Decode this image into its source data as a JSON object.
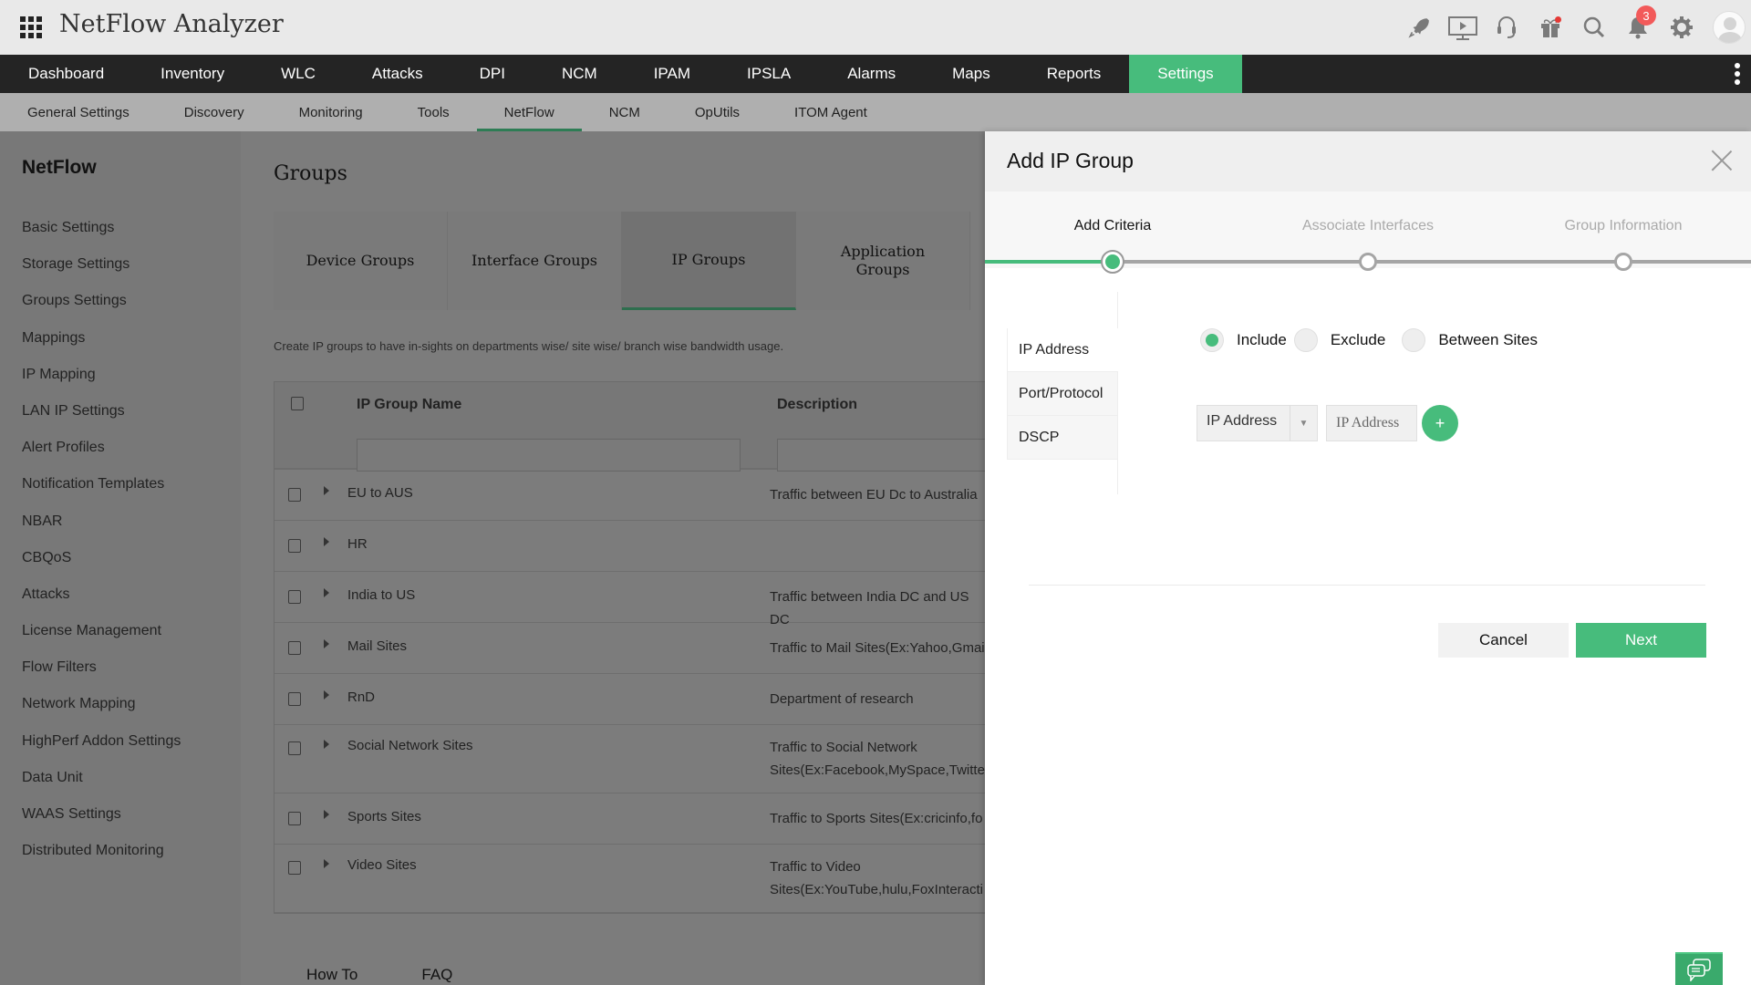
{
  "app": {
    "title": "NetFlow Analyzer"
  },
  "header_icons": [
    {
      "name": "rocket-icon",
      "glyph": "🚀"
    },
    {
      "name": "presentation-icon",
      "glyph": "▶"
    },
    {
      "name": "headset-icon",
      "glyph": "🎧"
    },
    {
      "name": "gift-icon",
      "glyph": "🎁"
    },
    {
      "name": "search-icon",
      "glyph": "🔍"
    },
    {
      "name": "bell-icon",
      "glyph": "🔔"
    },
    {
      "name": "gear-icon",
      "glyph": "⚙"
    }
  ],
  "notifications": {
    "count": "3"
  },
  "main_nav": {
    "items": [
      "Dashboard",
      "Inventory",
      "WLC",
      "Attacks",
      "DPI",
      "NCM",
      "IPAM",
      "IPSLA",
      "Alarms",
      "Maps",
      "Reports",
      "Settings"
    ],
    "active": "Settings"
  },
  "sub_nav": {
    "items": [
      "General Settings",
      "Discovery",
      "Monitoring",
      "Tools",
      "NetFlow",
      "NCM",
      "OpUtils",
      "ITOM Agent"
    ],
    "active": "NetFlow"
  },
  "sidebar": {
    "title": "NetFlow",
    "items": [
      "Basic Settings",
      "Storage Settings",
      "Groups Settings",
      "Mappings",
      "IP Mapping",
      "LAN IP Settings",
      "Alert Profiles",
      "Notification Templates",
      "NBAR",
      "CBQoS",
      "Attacks",
      "License Management",
      "Flow Filters",
      "Network Mapping",
      "HighPerf Addon Settings",
      "Data Unit",
      "WAAS Settings",
      "Distributed Monitoring"
    ]
  },
  "groups_page": {
    "title": "Groups",
    "tabs": [
      "Device Groups",
      "Interface Groups",
      "IP Groups",
      "Application Groups"
    ],
    "active_tab": "IP Groups",
    "description": "Create IP groups to have in-sights on departments wise/ site wise/ branch wise bandwidth usage.",
    "table": {
      "columns": [
        "IP Group Name",
        "Description"
      ],
      "rows": [
        {
          "name": "EU to AUS",
          "desc": "Traffic between EU Dc to Australia"
        },
        {
          "name": "HR",
          "desc": ""
        },
        {
          "name": "India to US",
          "desc": "Traffic between India DC and US DC"
        },
        {
          "name": "Mail Sites",
          "desc": "Traffic to Mail Sites(Ex:Yahoo,Gmail"
        },
        {
          "name": "RnD",
          "desc": "Department of research"
        },
        {
          "name": "Social Network Sites",
          "desc": "Traffic to Social Network\nSites(Ex:Facebook,MySpace,Twitter"
        },
        {
          "name": "Sports Sites",
          "desc": "Traffic to Sports Sites(Ex:cricinfo,fo"
        },
        {
          "name": "Video Sites",
          "desc": "Traffic to Video\nSites(Ex:YouTube,hulu,FoxInteracti"
        }
      ]
    },
    "links": [
      "How To",
      "FAQ"
    ]
  },
  "modal": {
    "title": "Add IP Group",
    "steps": [
      "Add Criteria",
      "Associate Interfaces",
      "Group Information"
    ],
    "active_step": "Add Criteria",
    "criteria_tabs": [
      "IP Address",
      "Port/Protocol",
      "DSCP"
    ],
    "active_criteria": "IP Address",
    "radio_options": [
      "Include",
      "Exclude",
      "Between Sites"
    ],
    "selected_radio": "Include",
    "ip_type_select": {
      "value": "IP Address"
    },
    "ip_input": {
      "value": "",
      "placeholder": "IP Address"
    },
    "add_label": "+",
    "cancel_label": "Cancel",
    "next_label": "Next"
  },
  "colors": {
    "accent": "#47bc7c",
    "nav_bg": "#242424",
    "badge": "#f25a5a"
  }
}
